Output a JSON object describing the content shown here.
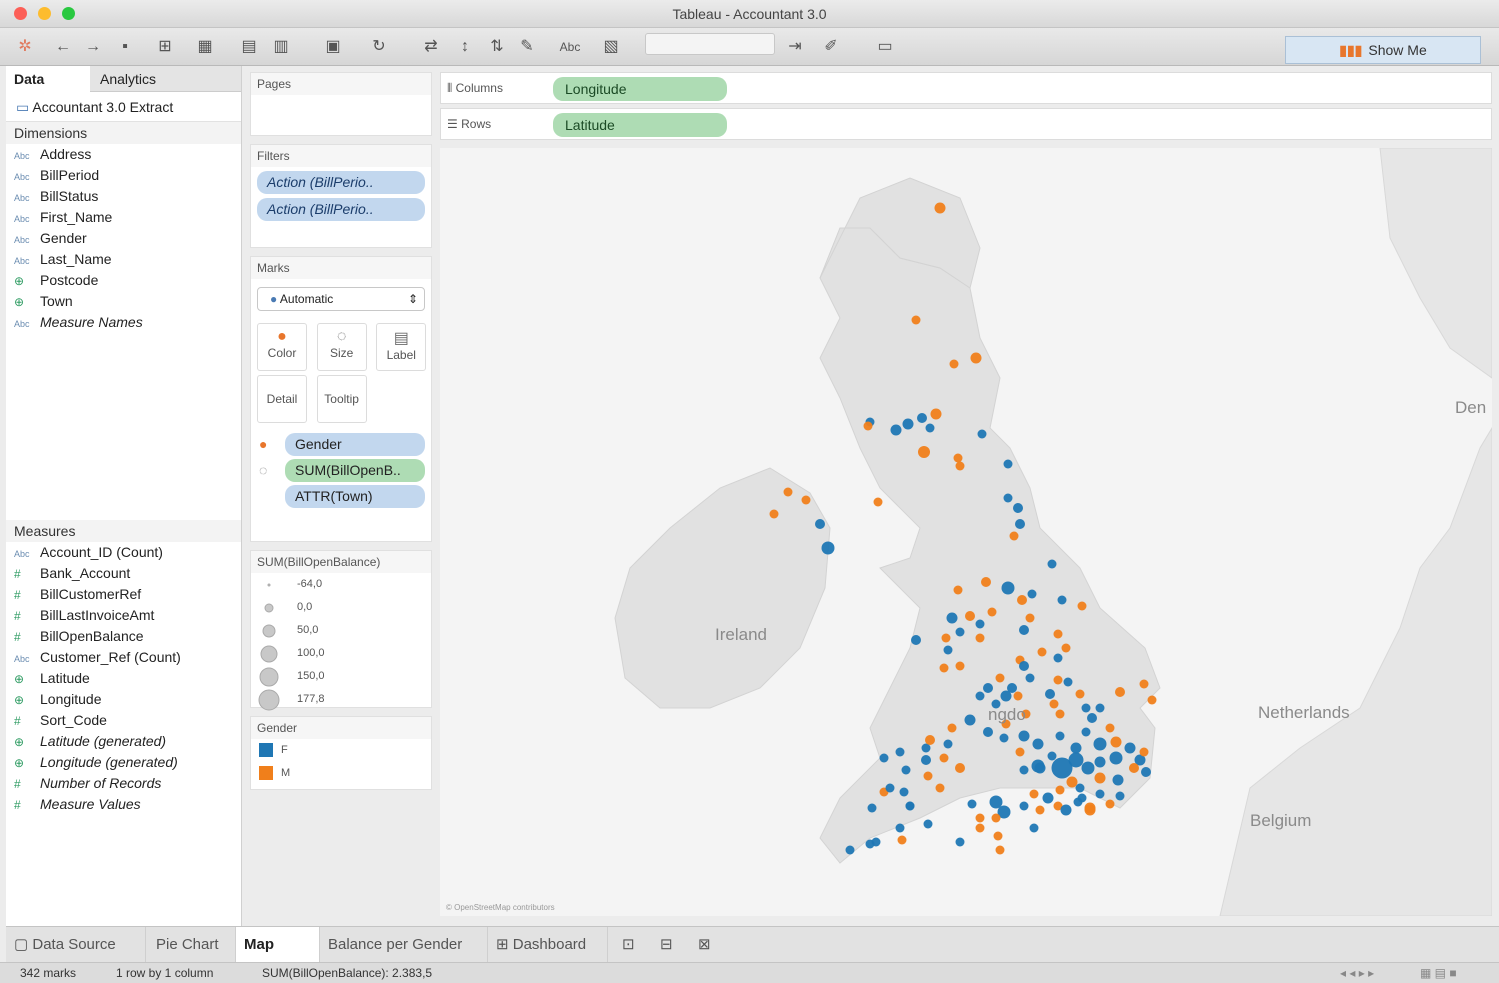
{
  "window": {
    "title": "Tableau - Accountant 3.0"
  },
  "toolbar": {
    "show_me_label": "Show Me",
    "abc_label": "Abc"
  },
  "data_pane": {
    "tabs": [
      "Data",
      "Analytics"
    ],
    "datasource": "Accountant 3.0 Extract",
    "dimensions_header": "Dimensions",
    "dimensions": [
      {
        "type": "Abc",
        "name": "Address"
      },
      {
        "type": "Abc",
        "name": "BillPeriod"
      },
      {
        "type": "Abc",
        "name": "BillStatus"
      },
      {
        "type": "Abc",
        "name": "First_Name"
      },
      {
        "type": "Abc",
        "name": "Gender"
      },
      {
        "type": "Abc",
        "name": "Last_Name"
      },
      {
        "type": "globe",
        "name": "Postcode"
      },
      {
        "type": "globe",
        "name": "Town"
      },
      {
        "type": "Abc",
        "name": "Measure Names"
      }
    ],
    "measures_header": "Measures",
    "measures": [
      {
        "type": "Abc",
        "name": "Account_ID (Count)"
      },
      {
        "type": "#",
        "name": "Bank_Account"
      },
      {
        "type": "#",
        "name": "BillCustomerRef"
      },
      {
        "type": "#",
        "name": "BillLastInvoiceAmt"
      },
      {
        "type": "#",
        "name": "BillOpenBalance"
      },
      {
        "type": "Abc",
        "name": "Customer_Ref (Count)"
      },
      {
        "type": "globe",
        "name": "Latitude"
      },
      {
        "type": "globe",
        "name": "Longitude"
      },
      {
        "type": "#",
        "name": "Sort_Code"
      },
      {
        "type": "globe",
        "name": "Latitude (generated)"
      },
      {
        "type": "globe",
        "name": "Longitude (generated)"
      },
      {
        "type": "#",
        "name": "Number of Records"
      },
      {
        "type": "#",
        "name": "Measure Values"
      }
    ]
  },
  "pages": {
    "label": "Pages"
  },
  "filters": {
    "label": "Filters",
    "items": [
      "Action (BillPerio..",
      "Action (BillPerio.."
    ]
  },
  "marks": {
    "label": "Marks",
    "type": "Automatic",
    "buttons": [
      "Color",
      "Size",
      "Label",
      "Detail",
      "Tooltip"
    ],
    "pills": [
      {
        "icon": "color",
        "text": "Gender",
        "color": "#c2d7ee"
      },
      {
        "icon": "size",
        "text": "SUM(BillOpenB..",
        "color": "#aedcb4"
      },
      {
        "icon": "",
        "text": "ATTR(Town)",
        "color": "#c2d7ee"
      }
    ]
  },
  "size_legend": {
    "title": "SUM(BillOpenBalance)",
    "items": [
      "-64,0",
      "0,0",
      "50,0",
      "100,0",
      "150,0",
      "177,8"
    ]
  },
  "gender_legend": {
    "title": "Gender",
    "items": [
      {
        "label": "F",
        "color": "#1f77b4"
      },
      {
        "label": "M",
        "color": "#f07f1b"
      }
    ]
  },
  "shelves": {
    "columns": {
      "label": "Columns",
      "pill": "Longitude"
    },
    "rows": {
      "label": "Rows",
      "pill": "Latitude"
    }
  },
  "map": {
    "labels": {
      "ireland": "Ireland",
      "netherlands": "Netherlands",
      "belgium": "Belgium",
      "denmark": "Den",
      "uk": "ngdo"
    },
    "attribution": "© OpenStreetMap contributors",
    "colors": {
      "F": "#1f77b4",
      "M": "#f07f1b"
    }
  },
  "sheet_tabs": [
    {
      "label": "Data Source",
      "active": false
    },
    {
      "label": "Pie Chart",
      "active": false
    },
    {
      "label": "Map",
      "active": true
    },
    {
      "label": "Balance per Gender",
      "active": false
    },
    {
      "label": "Dashboard",
      "active": false
    }
  ],
  "status": {
    "marks": "342 marks",
    "dims": "1 row by 1 column",
    "sum": "SUM(BillOpenBalance): 2.383,5"
  }
}
